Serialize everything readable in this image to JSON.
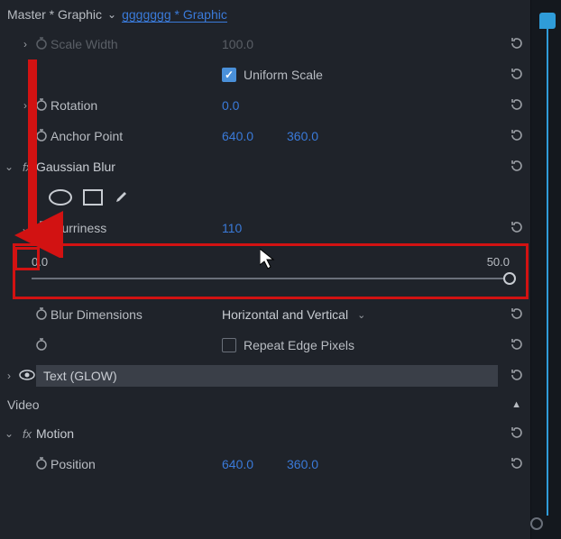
{
  "header": {
    "master": "Master * Graphic",
    "clip": "ggggggg * Graphic"
  },
  "scaleWidth": {
    "label": "Scale Width",
    "value": "100.0"
  },
  "uniformScale": {
    "label": "Uniform Scale",
    "checked": true
  },
  "rotation": {
    "label": "Rotation",
    "value": "0.0"
  },
  "anchor": {
    "label": "Anchor Point",
    "x": "640.0",
    "y": "360.0"
  },
  "gaussian": {
    "label": "Gaussian Blur"
  },
  "blurriness": {
    "label": "Blurriness",
    "value": "110"
  },
  "slider": {
    "min": "0.0",
    "max": "50.0"
  },
  "blurDim": {
    "label": "Blur Dimensions",
    "value": "Horizontal and Vertical"
  },
  "repeatEdge": {
    "label": "Repeat Edge Pixels"
  },
  "textGlow": {
    "label": "Text (GLOW)"
  },
  "video": {
    "label": "Video"
  },
  "motion": {
    "label": "Motion"
  },
  "position": {
    "label": "Position",
    "x": "640.0",
    "y": "360.0"
  }
}
